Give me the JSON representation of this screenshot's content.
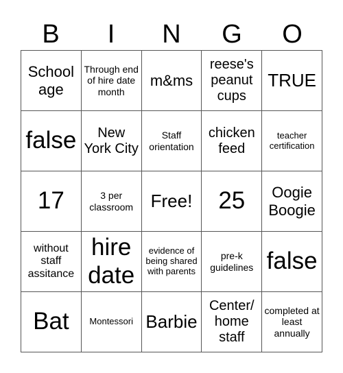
{
  "header": [
    "B",
    "I",
    "N",
    "G",
    "O"
  ],
  "cells": [
    [
      "School age",
      "Through end of hire date month",
      "m&ms",
      "reese's peanut cups",
      "TRUE"
    ],
    [
      "false",
      "New York City",
      "Staff orientation",
      "chicken feed",
      "teacher certification"
    ],
    [
      "17",
      "3 per classroom",
      "Free!",
      "25",
      "Oogie Boogie"
    ],
    [
      "without staff assitance",
      "hire date",
      "evidence of being shared with parents",
      "pre-k guidelines",
      "false"
    ],
    [
      "Bat",
      "Montessori",
      "Barbie",
      "Center/ home staff",
      "completed at least annually"
    ]
  ]
}
